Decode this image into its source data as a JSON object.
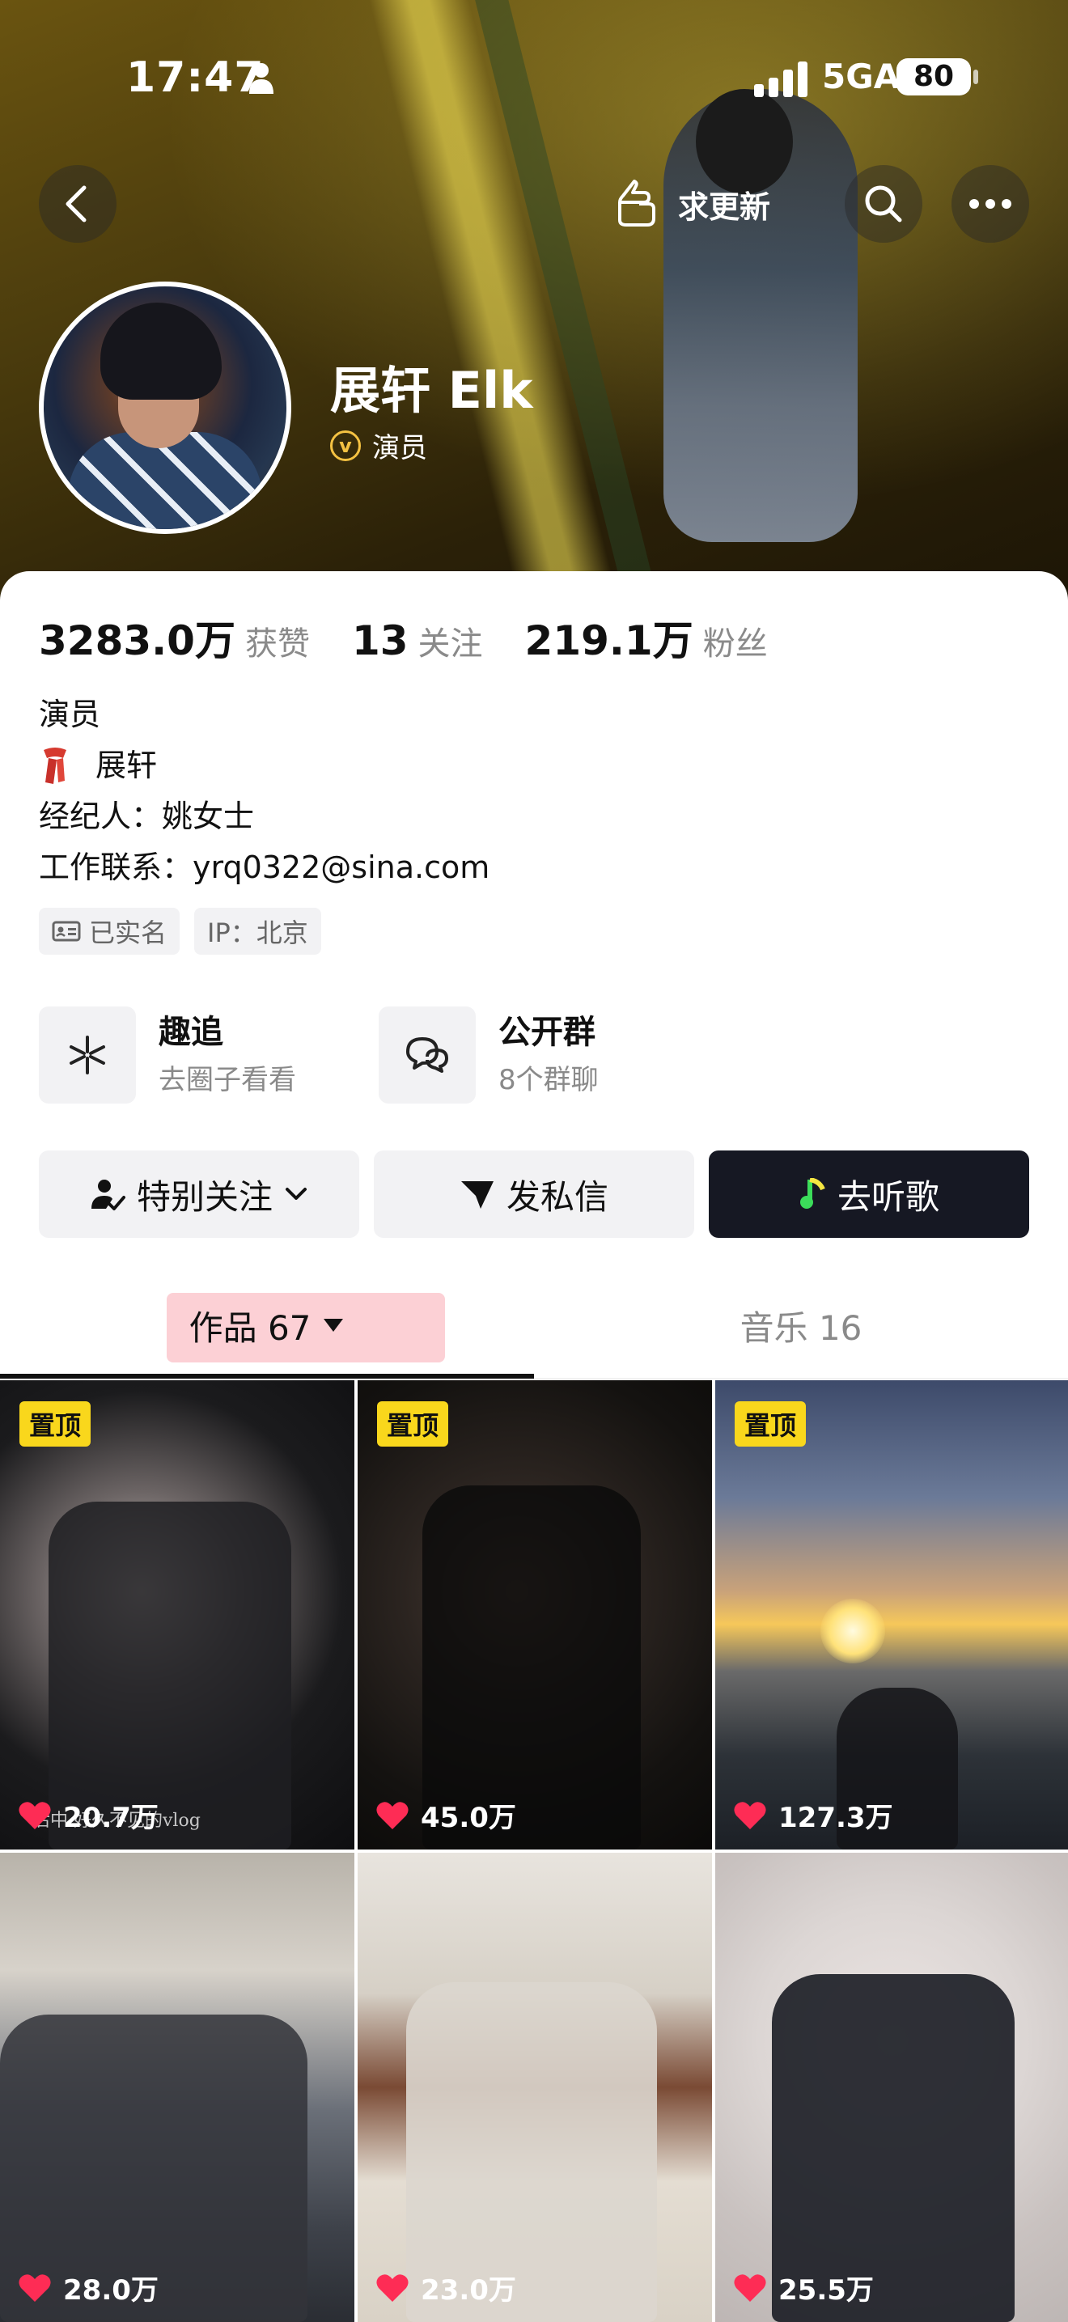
{
  "status_bar": {
    "time": "17:47",
    "network": "5GA",
    "battery": "80"
  },
  "nav": {
    "update_label": "求更新"
  },
  "profile": {
    "name": "展轩 Elk",
    "verified_title": "演员"
  },
  "stats": [
    {
      "value": "3283.0万",
      "label": "获赞"
    },
    {
      "value": "13",
      "label": "关注"
    },
    {
      "value": "219.1万",
      "label": "粉丝"
    }
  ],
  "bio": {
    "line1": "演员",
    "line2": "展轩",
    "line3": "经纪人：姚女士",
    "line4": "工作联系：yrq0322@sina.com"
  },
  "tags": {
    "verified_name": "已实名",
    "ip": "IP：北京"
  },
  "features": [
    {
      "title": "趣追",
      "subtitle": "去圈子看看",
      "icon": "sparkle-icon"
    },
    {
      "title": "公开群",
      "subtitle": "8个群聊",
      "icon": "chat-bubbles-icon"
    }
  ],
  "actions": {
    "follow": "特别关注",
    "message": "发私信",
    "listen": "去听歌"
  },
  "tabs": {
    "works": "作品 67",
    "music": "音乐 16"
  },
  "videos": [
    {
      "pinned": "置顶",
      "likes": "20.7万",
      "caption": "后中 好久不见的vlog"
    },
    {
      "pinned": "置顶",
      "likes": "45.0万"
    },
    {
      "pinned": "置顶",
      "likes": "127.3万"
    },
    {
      "likes": "28.0万"
    },
    {
      "likes": "23.0万"
    },
    {
      "likes": "25.5万"
    }
  ],
  "colors": {
    "pin_badge": "#f9d71c",
    "dark_button": "#161823",
    "works_highlight": "#fcd0d5",
    "verify_badge": "#f5c242"
  }
}
